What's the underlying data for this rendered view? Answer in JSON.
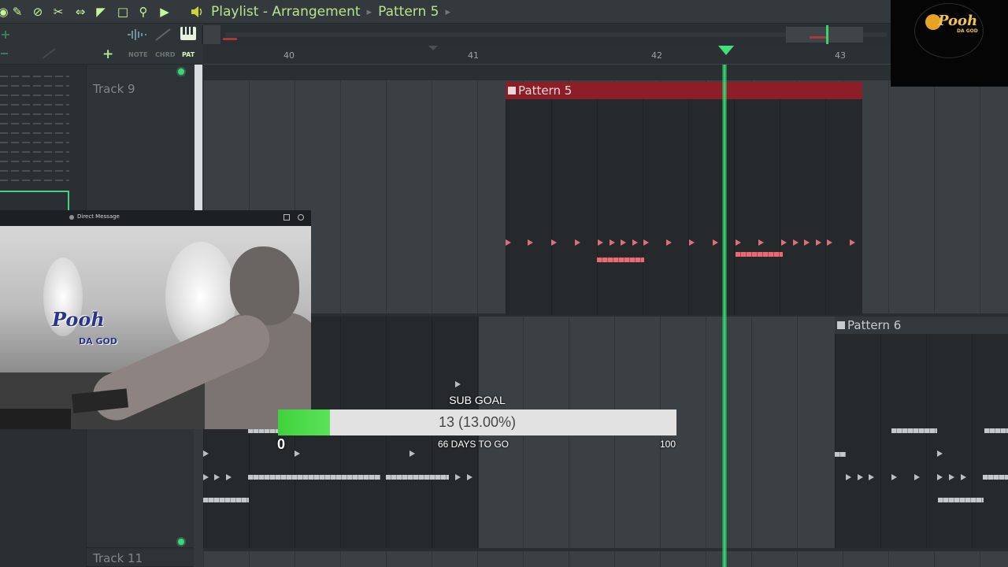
{
  "colors": {
    "accent_green": "#33e076",
    "pattern5_red": "#8c1e28",
    "note_red": "#e16d78",
    "note_gray": "#b9bfc2",
    "goal_fill": "#3fd23c"
  },
  "toolbar": {
    "icons": [
      "magnet-icon",
      "pencil-icon",
      "mute-icon",
      "slice-icon",
      "stretch-icon",
      "select-icon",
      "fullscreen-icon",
      "zoom-icon",
      "speaker-icon"
    ],
    "title": "Playlist - Arrangement",
    "separator": "▸",
    "pattern": "Pattern 5"
  },
  "row3": {
    "labels": [
      "NOTE",
      "CHRD",
      "PAT"
    ]
  },
  "ruler": {
    "bars": [
      "40",
      "41",
      "42",
      "43"
    ]
  },
  "tracks": {
    "track9": "Track 9",
    "track11": "Track 11"
  },
  "clips": {
    "pattern5": "Pattern 5",
    "pattern6": "Pattern 6"
  },
  "webcam": {
    "window_title": "Direct Message",
    "logo_text": "Pooh",
    "logo_sub": "DA GOD"
  },
  "logo": {
    "text": "Pooh",
    "sub": "DA GOD"
  },
  "sub_goal": {
    "title": "SUB GOAL",
    "current": 13,
    "progress_text": "13 (13.00%)",
    "progress_fraction": 0.13,
    "min_label": "0",
    "days_text": "66 DAYS TO GO",
    "max_label": "100"
  }
}
